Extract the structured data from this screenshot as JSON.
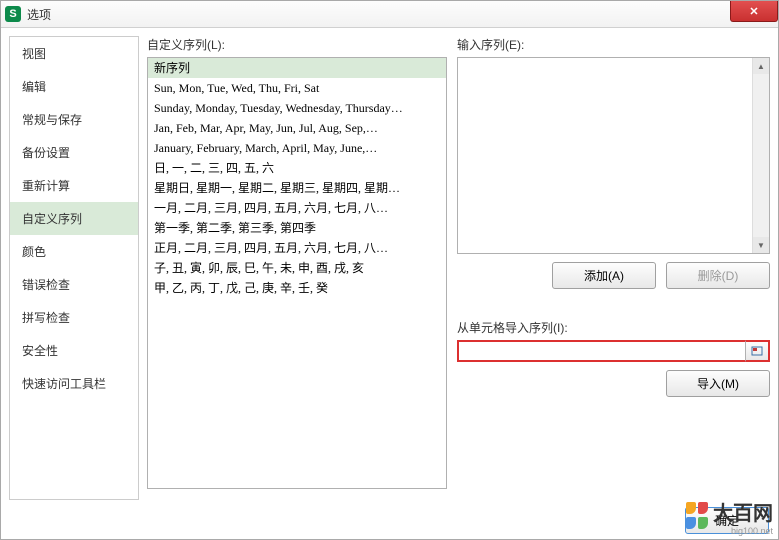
{
  "window": {
    "title": "选项",
    "icon_letter": "S"
  },
  "sidebar": {
    "items": [
      {
        "label": "视图"
      },
      {
        "label": "编辑"
      },
      {
        "label": "常规与保存"
      },
      {
        "label": "备份设置"
      },
      {
        "label": "重新计算"
      },
      {
        "label": "自定义序列"
      },
      {
        "label": "颜色"
      },
      {
        "label": "错误检查"
      },
      {
        "label": "拼写检查"
      },
      {
        "label": "安全性"
      },
      {
        "label": "快速访问工具栏"
      }
    ],
    "selected_index": 5
  },
  "custom_list": {
    "label": "自定义序列(L):",
    "items": [
      "新序列",
      "Sun, Mon, Tue, Wed, Thu, Fri, Sat",
      "Sunday, Monday, Tuesday, Wednesday, Thursday…",
      "Jan, Feb, Mar, Apr, May, Jun, Jul, Aug, Sep,…",
      "January, February, March, April, May, June,…",
      "日, 一, 二, 三, 四, 五, 六",
      "星期日, 星期一, 星期二, 星期三, 星期四, 星期…",
      "一月, 二月, 三月, 四月, 五月, 六月, 七月, 八…",
      "第一季, 第二季, 第三季, 第四季",
      "正月, 二月, 三月, 四月, 五月, 六月, 七月, 八…",
      "子, 丑, 寅, 卯, 辰, 巳, 午, 未, 申, 酉, 戌, 亥",
      "甲, 乙, 丙, 丁, 戊, 己, 庚, 辛, 壬, 癸"
    ],
    "selected_index": 0
  },
  "input_list": {
    "label": "输入序列(E):"
  },
  "buttons": {
    "add": "添加(A)",
    "delete": "删除(D)",
    "import": "导入(M)",
    "ok": "确定"
  },
  "import_section": {
    "label": "从单元格导入序列(I):",
    "value": ""
  },
  "watermark": {
    "text": "大百网",
    "sub": "big100.net"
  }
}
